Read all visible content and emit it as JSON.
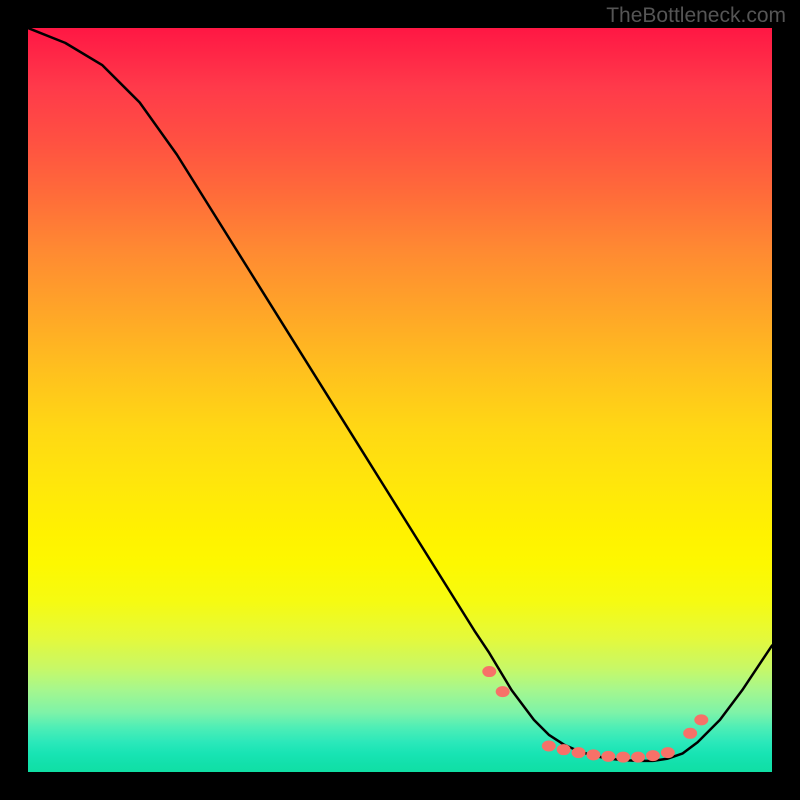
{
  "watermark": "TheBottleneck.com",
  "chart_data": {
    "type": "line",
    "title": "",
    "xlabel": "",
    "ylabel": "",
    "xlim": [
      0,
      100
    ],
    "ylim": [
      0,
      100
    ],
    "grid": false,
    "series": [
      {
        "name": "curve",
        "x": [
          0,
          5,
          10,
          15,
          20,
          25,
          30,
          35,
          40,
          45,
          50,
          55,
          60,
          62,
          65,
          68,
          70,
          72,
          74,
          76,
          78,
          80,
          82,
          84,
          86,
          88,
          90,
          93,
          96,
          100
        ],
        "y": [
          100,
          98,
          95,
          90,
          83,
          75,
          67,
          59,
          51,
          43,
          35,
          27,
          19,
          16,
          11,
          7,
          5,
          3.7,
          2.8,
          2.2,
          1.8,
          1.6,
          1.5,
          1.5,
          1.8,
          2.5,
          4,
          7,
          11,
          17
        ]
      }
    ],
    "markers": [
      {
        "x": 62.0,
        "y": 13.5
      },
      {
        "x": 63.8,
        "y": 10.8
      },
      {
        "x": 70.0,
        "y": 3.5
      },
      {
        "x": 72.0,
        "y": 3.0
      },
      {
        "x": 74.0,
        "y": 2.6
      },
      {
        "x": 76.0,
        "y": 2.3
      },
      {
        "x": 78.0,
        "y": 2.1
      },
      {
        "x": 80.0,
        "y": 2.0
      },
      {
        "x": 82.0,
        "y": 2.0
      },
      {
        "x": 84.0,
        "y": 2.2
      },
      {
        "x": 86.0,
        "y": 2.6
      },
      {
        "x": 89.0,
        "y": 5.2
      },
      {
        "x": 90.5,
        "y": 7.0
      }
    ],
    "marker_color": "#f77168",
    "curve_color": "#000000"
  }
}
